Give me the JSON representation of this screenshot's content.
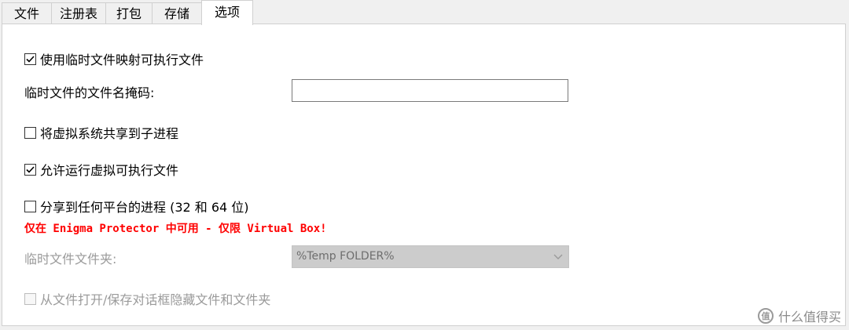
{
  "tabs": [
    {
      "label": "文件",
      "active": false
    },
    {
      "label": "注册表",
      "active": false
    },
    {
      "label": "打包",
      "active": false
    },
    {
      "label": "存储",
      "active": false
    },
    {
      "label": "选项",
      "active": true
    }
  ],
  "options": {
    "use_temp_file_mapping": {
      "label": "使用临时文件映射可执行文件",
      "checked": true
    },
    "temp_filename_mask": {
      "label": "临时文件的文件名掩码:",
      "value": ""
    },
    "share_virtual_system": {
      "label": "将虚拟系统共享到子进程",
      "checked": false
    },
    "allow_run_virtual_exe": {
      "label": "允许运行虚拟可执行文件",
      "checked": true
    },
    "share_any_platform": {
      "label": "分享到任何平台的进程 (32 和 64 位)",
      "checked": false
    },
    "warning": "仅在 Enigma Protector 中可用 - 仅限 Virtual Box!",
    "temp_folder": {
      "label": "临时文件文件夹:",
      "value": "%Temp FOLDER%"
    },
    "hide_from_dialogs": {
      "label": "从文件打开/保存对话框隐藏文件和文件夹",
      "checked": false,
      "disabled": true
    }
  },
  "watermark": {
    "logo": "值",
    "text": "什么值得买"
  },
  "colors": {
    "warning": "#ff0000",
    "disabled_text": "#9a9a9a",
    "disabled_field": "#cccccc"
  }
}
